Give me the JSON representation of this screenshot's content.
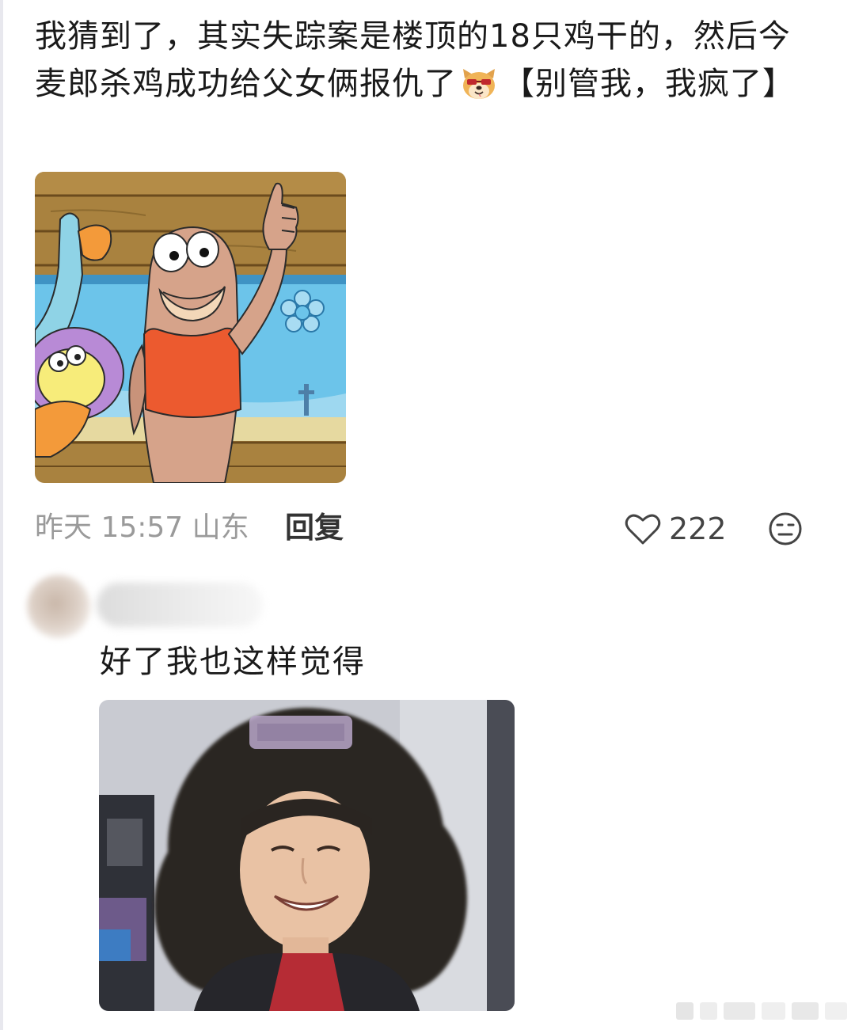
{
  "comment": {
    "line_part1": "我猜到了，其实失踪案是楼顶的18只鸡干的，然后今麦郎杀鸡成功给父女俩报仇了",
    "line_part2": "【别管我，我疯了】",
    "emoji": "doge-sunglasses-emoji",
    "image": "spongebob-fish-thumbs-up-meme"
  },
  "meta": {
    "time_location": "昨天 15:57 山东",
    "reply_label": "回复",
    "like_count": "222",
    "like_icon": "heart-outline-icon",
    "reaction_icon": "neutral-face-icon"
  },
  "reply": {
    "text": "好了我也这样觉得",
    "image": "curly-hair-person-meme"
  },
  "colors": {
    "meta_gray": "#9a9a9a",
    "text": "#1a1a1a",
    "reply_label": "#333333"
  }
}
